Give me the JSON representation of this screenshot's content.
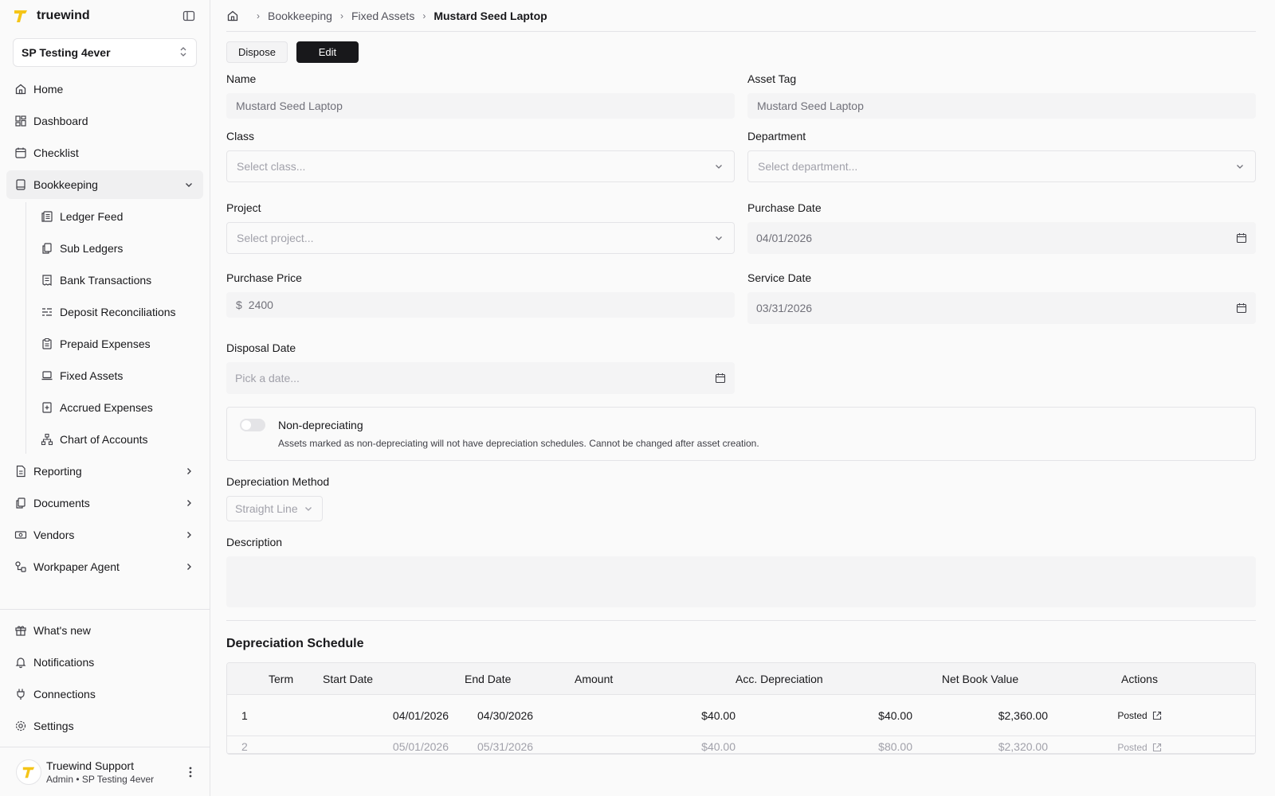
{
  "brand": {
    "name": "truewind",
    "accent": "#f5c518"
  },
  "org": {
    "selected": "SP Testing 4ever"
  },
  "nav": {
    "items": [
      {
        "label": "Home",
        "icon": "home-icon"
      },
      {
        "label": "Dashboard",
        "icon": "dashboard-icon"
      },
      {
        "label": "Checklist",
        "icon": "calendar-icon"
      }
    ],
    "bookkeeping": {
      "label": "Bookkeeping",
      "children": [
        {
          "label": "Ledger Feed"
        },
        {
          "label": "Sub Ledgers"
        },
        {
          "label": "Bank Transactions"
        },
        {
          "label": "Deposit Reconciliations"
        },
        {
          "label": "Prepaid Expenses"
        },
        {
          "label": "Fixed Assets"
        },
        {
          "label": "Accrued Expenses"
        },
        {
          "label": "Chart of Accounts"
        }
      ]
    },
    "collapsed": [
      {
        "label": "Reporting"
      },
      {
        "label": "Documents"
      },
      {
        "label": "Vendors"
      },
      {
        "label": "Workpaper Agent"
      }
    ],
    "bottom": [
      {
        "label": "What's new"
      },
      {
        "label": "Notifications"
      },
      {
        "label": "Connections"
      },
      {
        "label": "Settings"
      }
    ]
  },
  "user": {
    "name": "Truewind Support",
    "role": "Admin • SP Testing 4ever"
  },
  "breadcrumb": {
    "items": [
      "Bookkeeping",
      "Fixed Assets"
    ],
    "current": "Mustard Seed Laptop"
  },
  "toolbar": {
    "dispose": "Dispose",
    "edit": "Edit"
  },
  "form": {
    "name": {
      "label": "Name",
      "value": "Mustard Seed Laptop"
    },
    "asset_tag": {
      "label": "Asset Tag",
      "value": "Mustard Seed Laptop"
    },
    "class": {
      "label": "Class",
      "placeholder": "Select class..."
    },
    "department": {
      "label": "Department",
      "placeholder": "Select department..."
    },
    "project": {
      "label": "Project",
      "placeholder": "Select project..."
    },
    "purchase_date": {
      "label": "Purchase Date",
      "value": "04/01/2026"
    },
    "purchase_price": {
      "label": "Purchase Price",
      "currency": "$",
      "value": "2400"
    },
    "service_date": {
      "label": "Service Date",
      "value": "03/31/2026"
    },
    "disposal_date": {
      "label": "Disposal Date",
      "placeholder": "Pick a date..."
    },
    "non_depreciating": {
      "title": "Non-depreciating",
      "desc": "Assets marked as non-depreciating will not have depreciation schedules. Cannot be changed after asset creation."
    },
    "depreciation_method": {
      "label": "Depreciation Method",
      "value": "Straight Line"
    },
    "description": {
      "label": "Description"
    }
  },
  "schedule": {
    "title": "Depreciation Schedule",
    "headers": [
      "Term",
      "Start Date",
      "End Date",
      "Amount",
      "Acc. Depreciation",
      "Net Book Value",
      "Actions"
    ],
    "rows": [
      {
        "term": "1",
        "start": "04/01/2026",
        "end": "04/30/2026",
        "amount": "$40.00",
        "acc": "$40.00",
        "nbv": "$2,360.00",
        "action": "Posted"
      },
      {
        "term": "2",
        "start": "05/01/2026",
        "end": "05/31/2026",
        "amount": "$40.00",
        "acc": "$80.00",
        "nbv": "$2,320.00",
        "action": "Posted"
      }
    ]
  }
}
